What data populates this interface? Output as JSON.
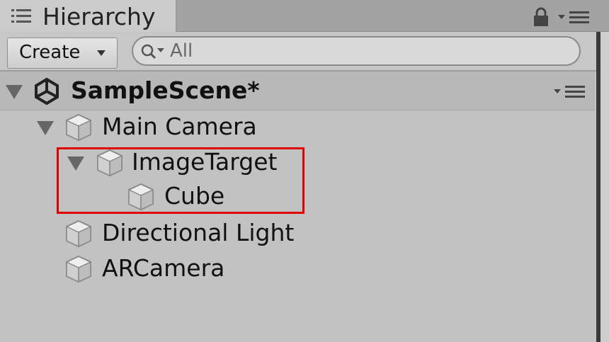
{
  "tab": {
    "title": "Hierarchy",
    "icon": "list-icon"
  },
  "header_icons": {
    "lock": "lock-icon",
    "menu": "panel-menu-icon"
  },
  "toolbar": {
    "create_label": "Create",
    "search_placeholder": "All",
    "search_icon": "search-icon"
  },
  "scene": {
    "name": "SampleScene*",
    "icon": "unity-logo-icon",
    "expanded": true
  },
  "tree": [
    {
      "label": "Main Camera",
      "depth": 0,
      "expanded": true,
      "icon": "gameobject-cube-icon"
    },
    {
      "label": "ImageTarget",
      "depth": 1,
      "expanded": true,
      "icon": "gameobject-cube-icon"
    },
    {
      "label": "Cube",
      "depth": 2,
      "expanded": null,
      "icon": "gameobject-cube-icon"
    },
    {
      "label": "Directional Light",
      "depth": 0,
      "expanded": null,
      "icon": "gameobject-cube-icon"
    },
    {
      "label": "ARCamera",
      "depth": 0,
      "expanded": null,
      "icon": "gameobject-cube-icon"
    }
  ],
  "annotation": {
    "color": "#e00000",
    "highlighted_items": [
      "ImageTarget",
      "Cube"
    ]
  },
  "colors": {
    "panel_bg": "#c2c2c2",
    "tab_bg": "#cbcbcb",
    "scene_row_bg": "#b8b8b8"
  }
}
